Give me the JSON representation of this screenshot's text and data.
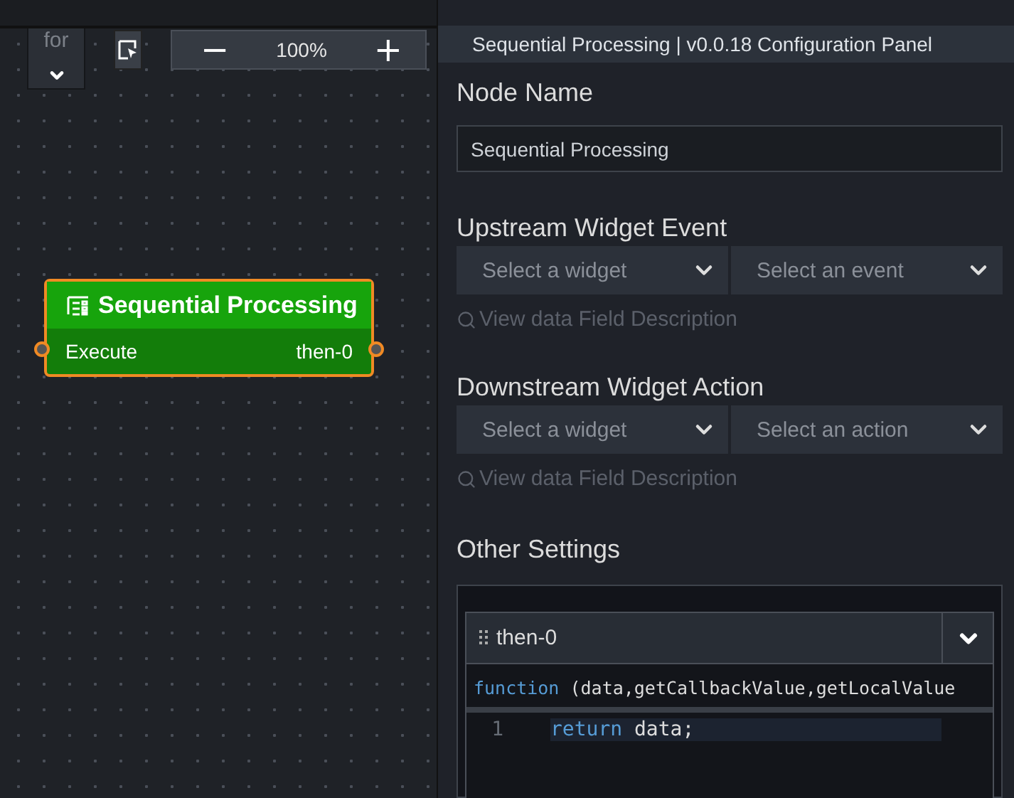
{
  "canvas_toolbar": {
    "dropdown_text": "for",
    "zoom": {
      "minus": "−",
      "value": "100%",
      "plus": "+"
    }
  },
  "node": {
    "title": "Sequential Processing",
    "input": "Execute",
    "output": "then-0",
    "selected": true
  },
  "panel": {
    "title": "Sequential Processing | v0.0.18 Configuration Panel",
    "node_name": {
      "label": "Node Name",
      "value": "Sequential Processing"
    },
    "upstream": {
      "label": "Upstream Widget Event",
      "selects": [
        "Select a widget",
        "Select an event"
      ],
      "link": "View data Field Description"
    },
    "downstream": {
      "label": "Downstream Widget Action",
      "selects": [
        "Select a widget",
        "Select an action"
      ],
      "link": "View data Field Description"
    },
    "other": {
      "label": "Other Settings",
      "branch": {
        "name": "then-0",
        "signature": "function (data,getCallbackValue,getLocalValue",
        "lines": [
          {
            "number": "1",
            "keyword": "return",
            "rest": " data;"
          }
        ]
      }
    }
  }
}
